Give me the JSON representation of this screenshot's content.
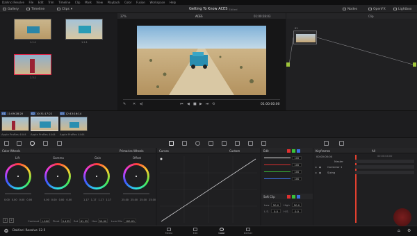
{
  "app": {
    "menu": [
      "DaVinci Resolve",
      "File",
      "Edit",
      "Trim",
      "Timeline",
      "Clip",
      "Mark",
      "View",
      "Playback",
      "Color",
      "Fusion",
      "Workspace",
      "Help"
    ],
    "project_title": "Getting To Know ACES",
    "project_status": "Edited",
    "version_label": "DaVinci Resolve 12.5"
  },
  "toolbar": {
    "gallery": "Gallery",
    "timeline": "Timeline",
    "clips": "Clips",
    "zoom": "37%",
    "clip_name": "ACES",
    "timecode": "01:00:28:03",
    "nodes": "Nodes",
    "openfx": "OpenFX",
    "lightbox": "Lightbox",
    "clip_mode": "Clip"
  },
  "gallery": {
    "stills": [
      {
        "label": "1.1.1"
      },
      {
        "label": "1.2.1"
      },
      {
        "label": "1.3.1"
      }
    ]
  },
  "viewer": {
    "timecode": "01:00:00:00"
  },
  "nodes": {
    "node_label": "01"
  },
  "clips": [
    {
      "num": "01",
      "tc": "11:09:28:20",
      "codec": "Apple ProRes 4444"
    },
    {
      "num": "02",
      "tc": "10:31:17:22",
      "codec": "Apple ProRes 4444"
    },
    {
      "num": "03",
      "tc": "12:43:16:14",
      "codec": "Apple ProRes 4444"
    }
  ],
  "color_wheels": {
    "title": "Color Wheels",
    "mode": "Primaries Wheels",
    "wheels": [
      {
        "name": "Lift",
        "values": [
          "0.00",
          "0.00",
          "0.00",
          "0.00"
        ]
      },
      {
        "name": "Gamma",
        "values": [
          "0.00",
          "0.00",
          "0.00",
          "0.00"
        ]
      },
      {
        "name": "Gain",
        "values": [
          "1.17",
          "1.17",
          "1.17",
          "1.17"
        ]
      },
      {
        "name": "Offset",
        "values": [
          "25.00",
          "25.00",
          "25.00",
          "25.00"
        ]
      }
    ],
    "contrast_label": "Contrast",
    "contrast": "1.000",
    "pivot_label": "Pivot",
    "pivot": "0.435",
    "sat_label": "Sat",
    "sat": "61.35",
    "hue_label": "Hue",
    "hue": "50.00",
    "lummix_label": "Lum Mix",
    "lummix": "100.00",
    "page_1": "1",
    "page_2": "2"
  },
  "curves": {
    "title": "Curves",
    "mode": "Custom"
  },
  "edit": {
    "title": "Edit",
    "values": [
      "100",
      "100",
      "100",
      "100"
    ],
    "softclip_title": "Soft Clip",
    "low_label": "Low",
    "low": "50.0",
    "high_label": "High",
    "high": "50.0",
    "ls_label": "L.S.",
    "ls": "0.0",
    "hs_label": "H.S.",
    "hs": "0.0",
    "colors": {
      "red": "#e03030",
      "green": "#3ac23a",
      "blue": "#3a6fe0"
    }
  },
  "keyframes": {
    "title": "Keyframes",
    "filter": "All",
    "timecode": "00:00:00:00",
    "tick": "00:00:04:00",
    "rows": [
      "Master",
      "Corrector 1",
      "Sizing"
    ]
  },
  "pages": [
    {
      "label": "Media",
      "active": false
    },
    {
      "label": "Edit",
      "active": false
    },
    {
      "label": "Color",
      "active": true
    },
    {
      "label": "Deliver",
      "active": false
    }
  ],
  "accent_color": "#e2402f"
}
